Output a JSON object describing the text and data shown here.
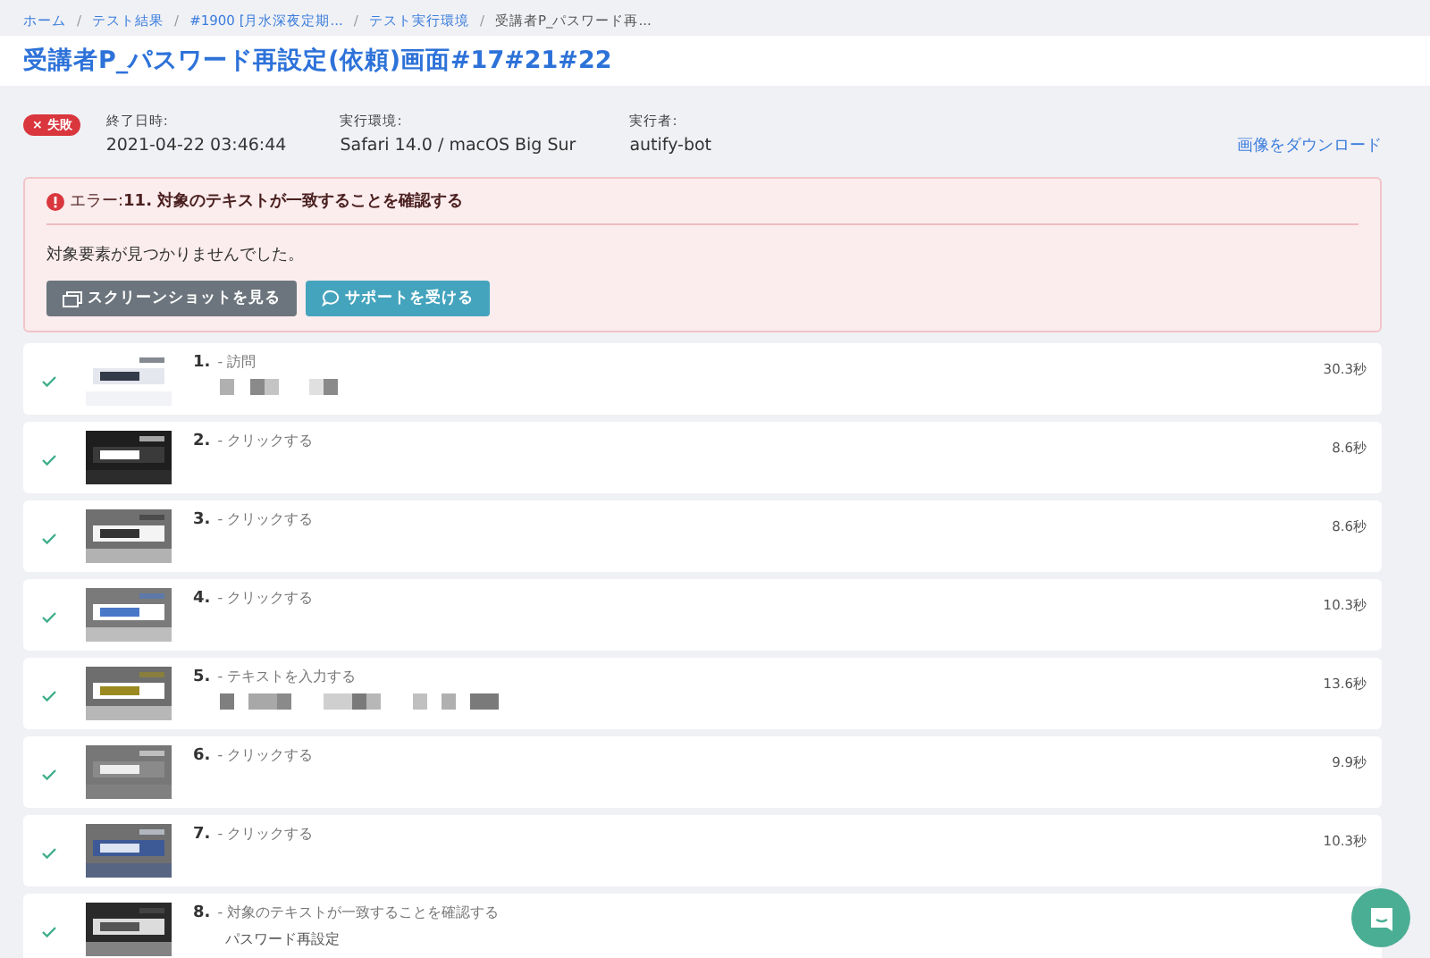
{
  "breadcrumb": [
    "ホーム",
    "テスト結果",
    "#1900 [月水深夜定期...",
    "テスト実行環境",
    "受講者P_パスワード再..."
  ],
  "breadcrumb_separator": "/",
  "title": "受講者P_パスワード再設定(依頼)画面#17#21#22",
  "result": {
    "failed": true,
    "icon": "×",
    "label": "失敗"
  },
  "meta": [
    {
      "label": "終了日時:",
      "value": "2021-04-22 03:46:44"
    },
    {
      "label": "実行環境:",
      "value": "Safari 14.0 / macOS Big Sur"
    },
    {
      "label": "実行者:",
      "value": "autify-bot"
    }
  ],
  "download_link": "画像をダウンロード",
  "error": {
    "prefix": "エラー:",
    "step": "11. 対象のテキストが一致することを確認する",
    "message": "対象要素が見つかりませんでした。",
    "buttons": [
      {
        "kind": "screenshot",
        "label": "スクリーンショットを見る"
      },
      {
        "kind": "support",
        "label": "サポートを受ける"
      }
    ]
  },
  "steps": [
    {
      "passed": true,
      "number": "1.",
      "action": "- 訪問",
      "masked_value": true,
      "duration": "30.3秒"
    },
    {
      "passed": true,
      "number": "2.",
      "action": "- クリックする",
      "masked_value": false,
      "duration": "8.6秒"
    },
    {
      "passed": true,
      "number": "3.",
      "action": "- クリックする",
      "masked_value": false,
      "duration": "8.6秒"
    },
    {
      "passed": true,
      "number": "4.",
      "action": "- クリックする",
      "masked_value": false,
      "duration": "10.3秒"
    },
    {
      "passed": true,
      "number": "5.",
      "action": "- テキストを入力する",
      "masked_value": true,
      "duration": "13.6秒"
    },
    {
      "passed": true,
      "number": "6.",
      "action": "- クリックする",
      "masked_value": false,
      "duration": "9.9秒"
    },
    {
      "passed": true,
      "number": "7.",
      "action": "- クリックする",
      "masked_value": false,
      "duration": "10.3秒"
    },
    {
      "passed": true,
      "number": "8.",
      "action": "- 対象のテキストが一致することを確認する",
      "masked_value": false,
      "detail": "パスワード再設定"
    }
  ]
}
